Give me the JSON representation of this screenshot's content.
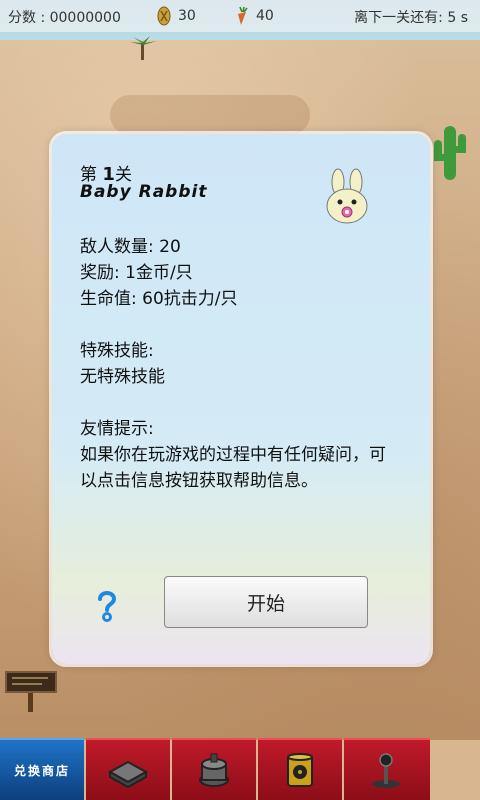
{
  "status_bar": {
    "score_label": "分数 : 00000000",
    "coins": "30",
    "carrots": "40",
    "next_level_label": "离下一关还有: 5 s"
  },
  "dialog": {
    "level_prefix": "第",
    "level_number": "1",
    "level_suffix": "关",
    "enemy_name": "Baby Rabbit",
    "enemy_count": "敌人数量: 20",
    "reward": "奖励: 1金币/只",
    "health": "生命值: 60抗击力/只",
    "skill_title": "特殊技能:",
    "skill_value": "无特殊技能",
    "tip_title": "友情提示:",
    "tip_text": "如果你在玩游戏的过程中有任何疑问，可以点击信息按钮获取帮助信息。",
    "start_button": "开始"
  },
  "toolbar": {
    "shop_label": "兑换商店",
    "tools": [
      "tower-base-icon",
      "cannon-tower-icon",
      "radioactive-barrel-icon",
      "lever-icon"
    ]
  },
  "colors": {
    "toolbar_red": "#b01525",
    "shop_blue": "#1f6fc3",
    "dialog_bg": "#cfe6f7"
  }
}
